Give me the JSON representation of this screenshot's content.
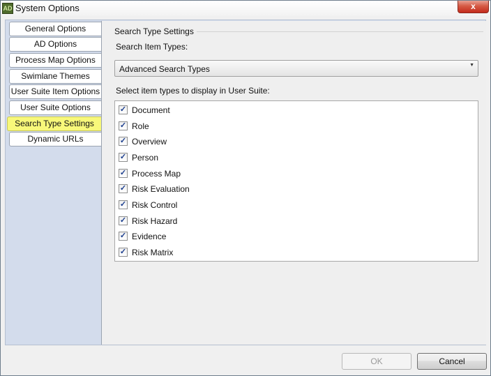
{
  "window": {
    "title": "System Options",
    "app_icon_text": "AD",
    "close_glyph": "x"
  },
  "tabs": [
    {
      "label": "General Options",
      "active": false
    },
    {
      "label": "AD Options",
      "active": false
    },
    {
      "label": "Process Map Options",
      "active": false
    },
    {
      "label": "Swimlane Themes",
      "active": false
    },
    {
      "label": "User Suite Item Options",
      "active": false
    },
    {
      "label": "User Suite Options",
      "active": false
    },
    {
      "label": "Search Type Settings",
      "active": true
    },
    {
      "label": "Dynamic URLs",
      "active": false
    }
  ],
  "panel": {
    "group_title": "Search Type Settings",
    "search_item_types_label": "Search Item Types:",
    "search_item_types_value": "Advanced Search Types",
    "list_label": "Select item types to display in User Suite:",
    "items": [
      {
        "label": "Document",
        "checked": true
      },
      {
        "label": "Role",
        "checked": true
      },
      {
        "label": "Overview",
        "checked": true
      },
      {
        "label": "Person",
        "checked": true
      },
      {
        "label": "Process Map",
        "checked": true
      },
      {
        "label": "Risk Evaluation",
        "checked": true
      },
      {
        "label": "Risk Control",
        "checked": true
      },
      {
        "label": "Risk Hazard",
        "checked": true
      },
      {
        "label": "Evidence",
        "checked": true
      },
      {
        "label": "Risk Matrix",
        "checked": true
      }
    ]
  },
  "buttons": {
    "ok_label": "OK",
    "ok_enabled": false,
    "cancel_label": "Cancel"
  },
  "colors": {
    "highlight": "#f8f87a",
    "tab_frame": "#d3dcec"
  }
}
